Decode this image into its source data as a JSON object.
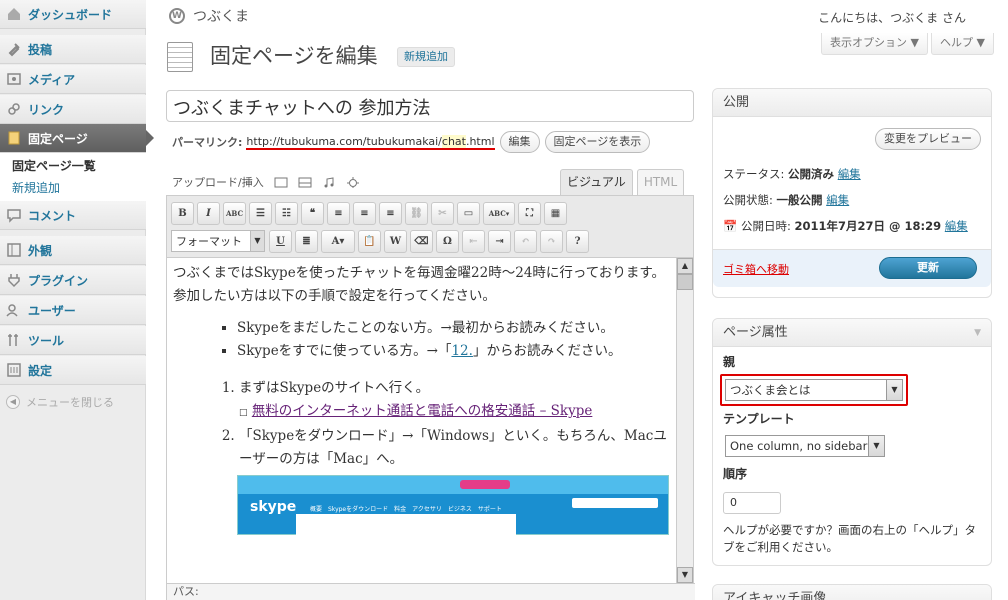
{
  "sidebar": {
    "items": [
      {
        "label": "ダッシュボード",
        "icon": "dashboard-icon"
      },
      {
        "label": "投稿",
        "icon": "pin-icon"
      },
      {
        "label": "メディア",
        "icon": "media-icon"
      },
      {
        "label": "リンク",
        "icon": "link-icon"
      },
      {
        "label": "固定ページ",
        "icon": "page-icon"
      },
      {
        "label": "コメント",
        "icon": "comment-icon"
      },
      {
        "label": "外観",
        "icon": "appearance-icon"
      },
      {
        "label": "プラグイン",
        "icon": "plugin-icon"
      },
      {
        "label": "ユーザー",
        "icon": "users-icon"
      },
      {
        "label": "ツール",
        "icon": "tools-icon"
      },
      {
        "label": "設定",
        "icon": "settings-icon"
      }
    ],
    "submenu": {
      "current": "固定ページ一覧",
      "add": "新規追加"
    },
    "collapse": "メニューを閉じる"
  },
  "header": {
    "site_name": "つぶくま",
    "howdy": "こんにちは、つぶくま さん",
    "screen_options": "表示オプション ▼",
    "help": "ヘルプ ▼"
  },
  "page": {
    "title": "固定ページを編集",
    "add_new": "新規追加"
  },
  "editor": {
    "title_value": "つぶくまチャットへの 参加方法",
    "permalink_label": "パーマリンク:",
    "permalink_pre": "http://tubukuma.com/tubukumakai/",
    "permalink_hl": "chat",
    "permalink_post": ".html",
    "edit_btn": "編集",
    "view_btn": "固定ページを表示",
    "upload_label": "アップロード/挿入",
    "tab_visual": "ビジュアル",
    "tab_html": "HTML",
    "format_select": "フォーマット",
    "path_label": "パス:",
    "content": {
      "p1": "つぶくまではSkypeを使ったチャットを毎週金曜22時～24時に行っております。",
      "p2": "参加したい方は以下の手順で設定を行ってください。",
      "ul1": "Skypeをまだしたことのない方。→最初からお読みください。",
      "ul2_pre": "Skypeをすでに使っている方。→「",
      "ul2_link": "12.",
      "ul2_post": "」からお読みください。",
      "ol1": "まずはSkypeのサイトへ行く。",
      "ol1_link": "無料のインターネット通話と電話への格安通話 – Skype",
      "ol2": "「Skypeをダウンロード」→「Windows」といく。もちろん、Macユーザーの方は「Mac」へ。",
      "skype_logo": "skype",
      "skype_nav": "概要　Skypeをダウンロード　料金　アクセサリ　ビジネス　サポート"
    }
  },
  "publish": {
    "title": "公開",
    "preview_btn": "変更をプレビュー",
    "status_label": "ステータス:",
    "status_value": "公開済み",
    "visibility_label": "公開状態:",
    "visibility_value": "一般公開",
    "date_label": "公開日時:",
    "date_value": "2011年7月27日 @ 18:29",
    "edit": "編集",
    "trash": "ゴミ箱へ移動",
    "update": "更新"
  },
  "attributes": {
    "title": "ページ属性",
    "parent_label": "親",
    "parent_value": "つぶくま会とは",
    "template_label": "テンプレート",
    "template_value": "One column, no sidebar",
    "order_label": "順序",
    "order_value": "0",
    "help": "ヘルプが必要ですか？画面の右上の「ヘルプ」タブをご利用ください。"
  },
  "featured": {
    "title": "アイキャッチ画像"
  }
}
